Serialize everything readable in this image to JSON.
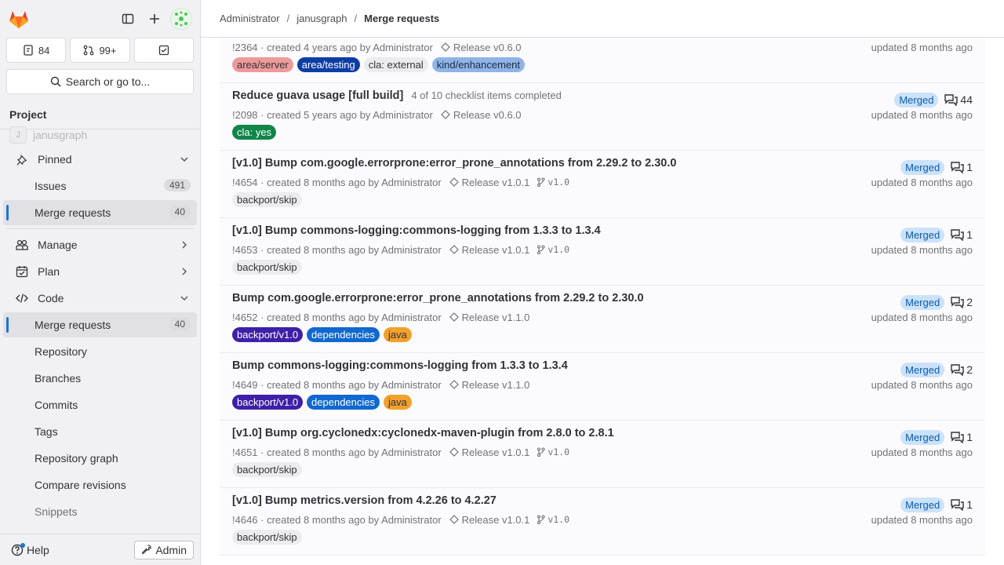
{
  "header": {
    "breadcrumb": [
      "Administrator",
      "janusgraph",
      "Merge requests"
    ]
  },
  "sidebar": {
    "counters": [
      {
        "icon": "issues-icon",
        "value": "84"
      },
      {
        "icon": "merge-request-icon",
        "value": "99+"
      },
      {
        "icon": "todo-icon",
        "value": ""
      }
    ],
    "search_label": "Search or go to...",
    "section_title": "Project",
    "project_name": "janusgraph",
    "project_initial": "J",
    "pinned_label": "Pinned",
    "pinned_items": [
      {
        "label": "Issues",
        "count": "491"
      },
      {
        "label": "Merge requests",
        "count": "40"
      }
    ],
    "groups": [
      {
        "label": "Manage",
        "icon": "users-icon"
      },
      {
        "label": "Plan",
        "icon": "plan-icon"
      },
      {
        "label": "Code",
        "icon": "code-icon"
      }
    ],
    "code_items": [
      {
        "label": "Merge requests",
        "count": "40"
      },
      {
        "label": "Repository"
      },
      {
        "label": "Branches"
      },
      {
        "label": "Commits"
      },
      {
        "label": "Tags"
      },
      {
        "label": "Repository graph"
      },
      {
        "label": "Compare revisions"
      },
      {
        "label": "Snippets"
      }
    ],
    "help_label": "Help",
    "admin_label": "Admin"
  },
  "merge_requests": [
    {
      "title": "",
      "checklist": "",
      "meta": "!2364 · created 4 years ago by Administrator",
      "milestone": "Release v0.6.0",
      "branch": "",
      "labels": [
        {
          "text": "area/server",
          "bg": "#ec9a9a",
          "fg": "#333238"
        },
        {
          "text": "area/testing",
          "bg": "#0b3da6",
          "fg": "#ffffff"
        },
        {
          "text": "cla: external",
          "bg": "#ececef",
          "fg": "#333238"
        },
        {
          "text": "kind/enhancement",
          "bg": "#8fb4e6",
          "fg": "#1f2a4a"
        }
      ],
      "status": "",
      "comments": "",
      "updated": "updated 8 months ago"
    },
    {
      "title": "Reduce guava usage [full build]",
      "checklist": "4 of 10 checklist items completed",
      "meta": "!2098 · created 5 years ago by Administrator",
      "milestone": "Release v0.6.0",
      "branch": "",
      "labels": [
        {
          "text": "cla: yes",
          "bg": "#108548",
          "fg": "#ffffff"
        }
      ],
      "status": "Merged",
      "comments": "44",
      "updated": "updated 8 months ago"
    },
    {
      "title": "[v1.0] Bump com.google.errorprone:error_prone_annotations from 2.29.2 to 2.30.0",
      "checklist": "",
      "meta": "!4654 · created 8 months ago by Administrator",
      "milestone": "Release v1.0.1",
      "branch": "v1.0",
      "labels": [
        {
          "text": "backport/skip",
          "bg": "#ececef",
          "fg": "#333238"
        }
      ],
      "status": "Merged",
      "comments": "1",
      "updated": "updated 8 months ago"
    },
    {
      "title": "[v1.0] Bump commons-logging:commons-logging from 1.3.3 to 1.3.4",
      "checklist": "",
      "meta": "!4653 · created 8 months ago by Administrator",
      "milestone": "Release v1.0.1",
      "branch": "v1.0",
      "labels": [
        {
          "text": "backport/skip",
          "bg": "#ececef",
          "fg": "#333238"
        }
      ],
      "status": "Merged",
      "comments": "1",
      "updated": "updated 8 months ago"
    },
    {
      "title": "Bump com.google.errorprone:error_prone_annotations from 2.29.2 to 2.30.0",
      "checklist": "",
      "meta": "!4652 · created 8 months ago by Administrator",
      "milestone": "Release v1.1.0",
      "branch": "",
      "labels": [
        {
          "text": "backport/v1.0",
          "bg": "#3e1fa8",
          "fg": "#ffffff"
        },
        {
          "text": "dependencies",
          "bg": "#1068d0",
          "fg": "#ffffff"
        },
        {
          "text": "java",
          "bg": "#f1a12c",
          "fg": "#333238"
        }
      ],
      "status": "Merged",
      "comments": "2",
      "updated": "updated 8 months ago"
    },
    {
      "title": "Bump commons-logging:commons-logging from 1.3.3 to 1.3.4",
      "checklist": "",
      "meta": "!4649 · created 8 months ago by Administrator",
      "milestone": "Release v1.1.0",
      "branch": "",
      "labels": [
        {
          "text": "backport/v1.0",
          "bg": "#3e1fa8",
          "fg": "#ffffff"
        },
        {
          "text": "dependencies",
          "bg": "#1068d0",
          "fg": "#ffffff"
        },
        {
          "text": "java",
          "bg": "#f1a12c",
          "fg": "#333238"
        }
      ],
      "status": "Merged",
      "comments": "2",
      "updated": "updated 8 months ago"
    },
    {
      "title": "[v1.0] Bump org.cyclonedx:cyclonedx-maven-plugin from 2.8.0 to 2.8.1",
      "checklist": "",
      "meta": "!4651 · created 8 months ago by Administrator",
      "milestone": "Release v1.0.1",
      "branch": "v1.0",
      "labels": [
        {
          "text": "backport/skip",
          "bg": "#ececef",
          "fg": "#333238"
        }
      ],
      "status": "Merged",
      "comments": "1",
      "updated": "updated 8 months ago"
    },
    {
      "title": "[v1.0] Bump metrics.version from 4.2.26 to 4.2.27",
      "checklist": "",
      "meta": "!4646 · created 8 months ago by Administrator",
      "milestone": "Release v1.0.1",
      "branch": "v1.0",
      "labels": [
        {
          "text": "backport/skip",
          "bg": "#ececef",
          "fg": "#333238"
        }
      ],
      "status": "Merged",
      "comments": "1",
      "updated": "updated 8 months ago"
    }
  ]
}
